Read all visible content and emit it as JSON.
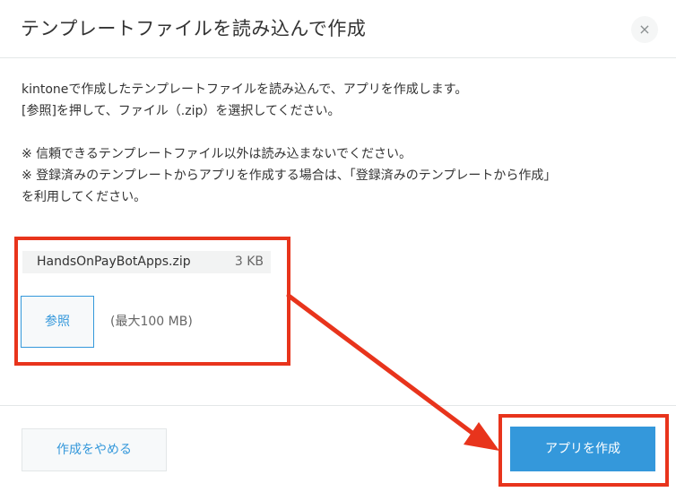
{
  "dialog": {
    "title": "テンプレートファイルを読み込んで作成",
    "close_icon": "×"
  },
  "body": {
    "line1": "kintoneで作成したテンプレートファイルを読み込んで、アプリを作成します。",
    "line2": "[参照]を押して、ファイル（.zip）を選択してください。",
    "note1": "※ 信頼できるテンプレートファイル以外は読み込まないでください。",
    "note2a": "※ 登録済みのテンプレートからアプリを作成する場合は、「登録済みのテンプレートから作成」",
    "note2b": "を利用してください。"
  },
  "file": {
    "name": "HandsOnPayBotApps.zip",
    "size": "3 KB"
  },
  "browse": {
    "label": "参照",
    "max_size": "(最大100 MB)"
  },
  "footer": {
    "cancel_label": "作成をやめる",
    "create_label": "アプリを作成"
  },
  "colors": {
    "accent": "#3498db",
    "annotation": "#e8341c"
  }
}
